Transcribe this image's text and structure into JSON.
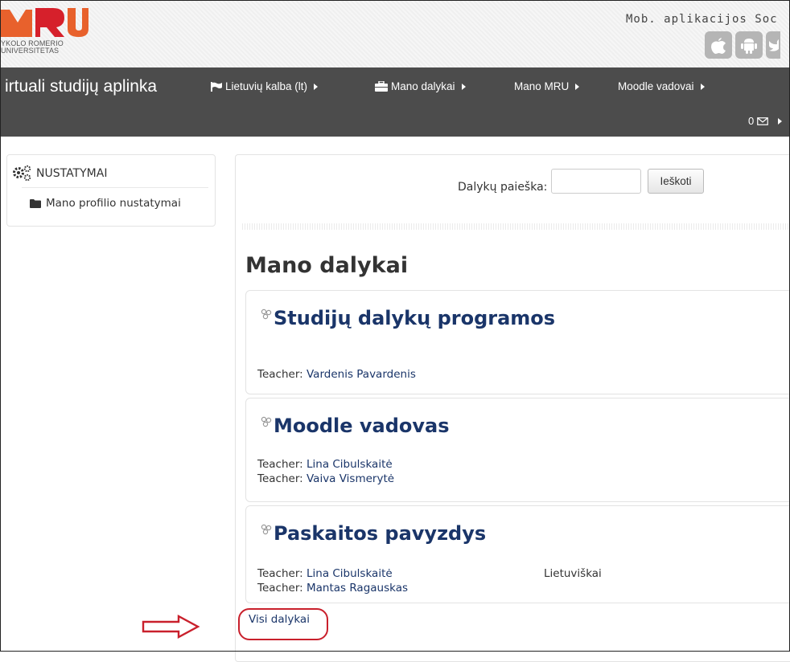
{
  "header": {
    "logo": {
      "letters": "MRU",
      "line1": "YKOLO ROMERIO",
      "line2": "UNIVERSITETAS"
    },
    "mob_text": "Mob. aplikacijos Soc",
    "app_icons": [
      "apple-icon",
      "android-icon",
      "twitter-icon"
    ]
  },
  "navbar": {
    "brand": "irtuali studijų aplinka",
    "items": [
      {
        "label": "Lietuvių kalba (lt)",
        "icon": "flag-icon"
      },
      {
        "label": "Mano dalykai",
        "icon": "briefcase-icon"
      },
      {
        "label": "Mano MRU",
        "icon": ""
      },
      {
        "label": "Moodle vadovai",
        "icon": ""
      }
    ],
    "messages_count": "0"
  },
  "sidebar": {
    "heading": "NUSTATYMAI",
    "links": [
      {
        "label": "Mano profilio nustatymai",
        "icon": "folder-icon"
      }
    ]
  },
  "search": {
    "label": "Dalykų paieška:",
    "value": "",
    "button": "Ieškoti"
  },
  "main": {
    "title": "Mano dalykai",
    "teacher_prefix": "Teacher:",
    "courses": [
      {
        "title": "Studijų dalykų programos",
        "teachers": [
          "Vardenis Pavardenis"
        ],
        "language": ""
      },
      {
        "title": "Moodle vadovas",
        "teachers": [
          "Lina Cibulskaitė",
          "Vaiva Vismerytė"
        ],
        "language": ""
      },
      {
        "title": "Paskaitos pavyzdys",
        "teachers": [
          "Lina Cibulskaitė",
          "Mantas Ragauskas"
        ],
        "language": "Lietuviškai"
      }
    ],
    "all_courses_link": "Visi dalykai"
  },
  "colors": {
    "navbar_bg": "#4c4c4c",
    "brand_orange": "#e8612c",
    "brand_red": "#d6202b",
    "link_blue": "#1a3569",
    "annotation_red": "#c9202c"
  }
}
